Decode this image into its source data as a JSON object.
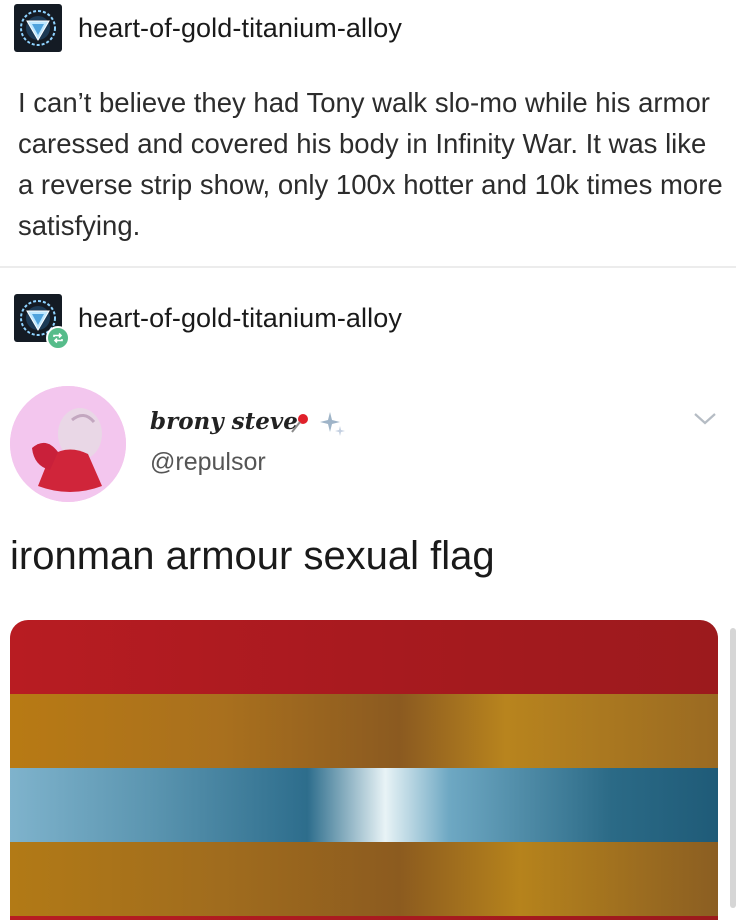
{
  "posts": [
    {
      "blog_name": "heart-of-gold-titanium-alloy",
      "avatar_icon": "arc-reactor-icon",
      "body": "I can’t believe they had Tony walk slo-mo while his armor caressed and covered his body in Infinity War. It was like a reverse strip show, only 100x hotter and 10k times more satisfying."
    },
    {
      "blog_name": "heart-of-gold-titanium-alloy",
      "avatar_icon": "arc-reactor-icon",
      "badge_icon": "reblog-icon"
    }
  ],
  "tweet": {
    "display_name": "brony steve",
    "emojis": [
      "pushpin-icon",
      "sparkles-icon"
    ],
    "handle": "@repulsor",
    "text": "ironman armour sexual flag",
    "menu_icon": "chevron-down-icon"
  },
  "flag": {
    "stripes": [
      "#b01b20",
      "#a8701c",
      "#5b95b0",
      "#a46f1d",
      "#b01b20"
    ]
  }
}
